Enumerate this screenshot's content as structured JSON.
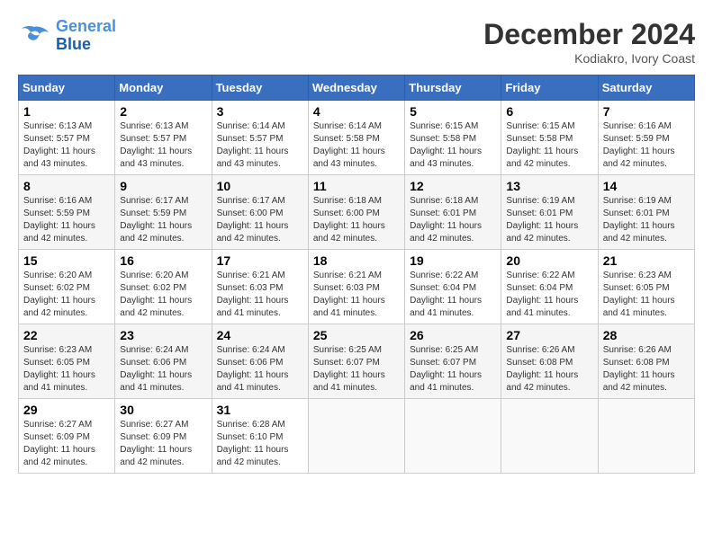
{
  "logo": {
    "line1": "General",
    "line2": "Blue"
  },
  "title": "December 2024",
  "location": "Kodiakro, Ivory Coast",
  "days_header": [
    "Sunday",
    "Monday",
    "Tuesday",
    "Wednesday",
    "Thursday",
    "Friday",
    "Saturday"
  ],
  "weeks": [
    [
      {
        "day": "1",
        "sunrise": "6:13 AM",
        "sunset": "5:57 PM",
        "daylight": "11 hours and 43 minutes."
      },
      {
        "day": "2",
        "sunrise": "6:13 AM",
        "sunset": "5:57 PM",
        "daylight": "11 hours and 43 minutes."
      },
      {
        "day": "3",
        "sunrise": "6:14 AM",
        "sunset": "5:57 PM",
        "daylight": "11 hours and 43 minutes."
      },
      {
        "day": "4",
        "sunrise": "6:14 AM",
        "sunset": "5:58 PM",
        "daylight": "11 hours and 43 minutes."
      },
      {
        "day": "5",
        "sunrise": "6:15 AM",
        "sunset": "5:58 PM",
        "daylight": "11 hours and 43 minutes."
      },
      {
        "day": "6",
        "sunrise": "6:15 AM",
        "sunset": "5:58 PM",
        "daylight": "11 hours and 42 minutes."
      },
      {
        "day": "7",
        "sunrise": "6:16 AM",
        "sunset": "5:59 PM",
        "daylight": "11 hours and 42 minutes."
      }
    ],
    [
      {
        "day": "8",
        "sunrise": "6:16 AM",
        "sunset": "5:59 PM",
        "daylight": "11 hours and 42 minutes."
      },
      {
        "day": "9",
        "sunrise": "6:17 AM",
        "sunset": "5:59 PM",
        "daylight": "11 hours and 42 minutes."
      },
      {
        "day": "10",
        "sunrise": "6:17 AM",
        "sunset": "6:00 PM",
        "daylight": "11 hours and 42 minutes."
      },
      {
        "day": "11",
        "sunrise": "6:18 AM",
        "sunset": "6:00 PM",
        "daylight": "11 hours and 42 minutes."
      },
      {
        "day": "12",
        "sunrise": "6:18 AM",
        "sunset": "6:01 PM",
        "daylight": "11 hours and 42 minutes."
      },
      {
        "day": "13",
        "sunrise": "6:19 AM",
        "sunset": "6:01 PM",
        "daylight": "11 hours and 42 minutes."
      },
      {
        "day": "14",
        "sunrise": "6:19 AM",
        "sunset": "6:01 PM",
        "daylight": "11 hours and 42 minutes."
      }
    ],
    [
      {
        "day": "15",
        "sunrise": "6:20 AM",
        "sunset": "6:02 PM",
        "daylight": "11 hours and 42 minutes."
      },
      {
        "day": "16",
        "sunrise": "6:20 AM",
        "sunset": "6:02 PM",
        "daylight": "11 hours and 42 minutes."
      },
      {
        "day": "17",
        "sunrise": "6:21 AM",
        "sunset": "6:03 PM",
        "daylight": "11 hours and 41 minutes."
      },
      {
        "day": "18",
        "sunrise": "6:21 AM",
        "sunset": "6:03 PM",
        "daylight": "11 hours and 41 minutes."
      },
      {
        "day": "19",
        "sunrise": "6:22 AM",
        "sunset": "6:04 PM",
        "daylight": "11 hours and 41 minutes."
      },
      {
        "day": "20",
        "sunrise": "6:22 AM",
        "sunset": "6:04 PM",
        "daylight": "11 hours and 41 minutes."
      },
      {
        "day": "21",
        "sunrise": "6:23 AM",
        "sunset": "6:05 PM",
        "daylight": "11 hours and 41 minutes."
      }
    ],
    [
      {
        "day": "22",
        "sunrise": "6:23 AM",
        "sunset": "6:05 PM",
        "daylight": "11 hours and 41 minutes."
      },
      {
        "day": "23",
        "sunrise": "6:24 AM",
        "sunset": "6:06 PM",
        "daylight": "11 hours and 41 minutes."
      },
      {
        "day": "24",
        "sunrise": "6:24 AM",
        "sunset": "6:06 PM",
        "daylight": "11 hours and 41 minutes."
      },
      {
        "day": "25",
        "sunrise": "6:25 AM",
        "sunset": "6:07 PM",
        "daylight": "11 hours and 41 minutes."
      },
      {
        "day": "26",
        "sunrise": "6:25 AM",
        "sunset": "6:07 PM",
        "daylight": "11 hours and 41 minutes."
      },
      {
        "day": "27",
        "sunrise": "6:26 AM",
        "sunset": "6:08 PM",
        "daylight": "11 hours and 42 minutes."
      },
      {
        "day": "28",
        "sunrise": "6:26 AM",
        "sunset": "6:08 PM",
        "daylight": "11 hours and 42 minutes."
      }
    ],
    [
      {
        "day": "29",
        "sunrise": "6:27 AM",
        "sunset": "6:09 PM",
        "daylight": "11 hours and 42 minutes."
      },
      {
        "day": "30",
        "sunrise": "6:27 AM",
        "sunset": "6:09 PM",
        "daylight": "11 hours and 42 minutes."
      },
      {
        "day": "31",
        "sunrise": "6:28 AM",
        "sunset": "6:10 PM",
        "daylight": "11 hours and 42 minutes."
      },
      null,
      null,
      null,
      null
    ]
  ]
}
